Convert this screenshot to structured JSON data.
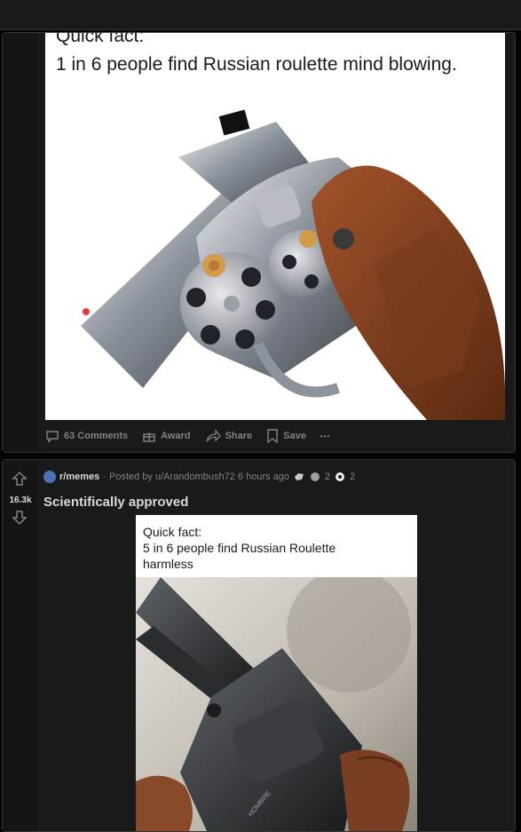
{
  "post1": {
    "meme_text_top": "Quick fact:",
    "meme_text": "1 in 6 people find Russian roulette mind blowing.",
    "actions": {
      "comments": "63 Comments",
      "award": "Award",
      "share": "Share",
      "save": "Save",
      "more": "•••"
    }
  },
  "post2": {
    "subreddit": "r/memes",
    "posted_by": "· Posted by u/Arandombush72 6 hours ago",
    "award_count_1": "2",
    "award_count_2": "2",
    "score": "16.3k",
    "title": "Scientifically approved",
    "meme_line1": "Quick fact:",
    "meme_line2": "5 in 6 people find Russian Roulette",
    "meme_line3": "harmless"
  },
  "colors": {
    "background": "#030303",
    "card": "#1a1a1b",
    "border": "#343536",
    "text_primary": "#d7dadc",
    "text_muted": "#818384"
  },
  "icons": [
    "comment-icon",
    "gift-icon",
    "share-icon",
    "bookmark-icon",
    "more-icon",
    "upvote-icon",
    "downvote-icon",
    "subreddit-icon",
    "award-icon"
  ]
}
